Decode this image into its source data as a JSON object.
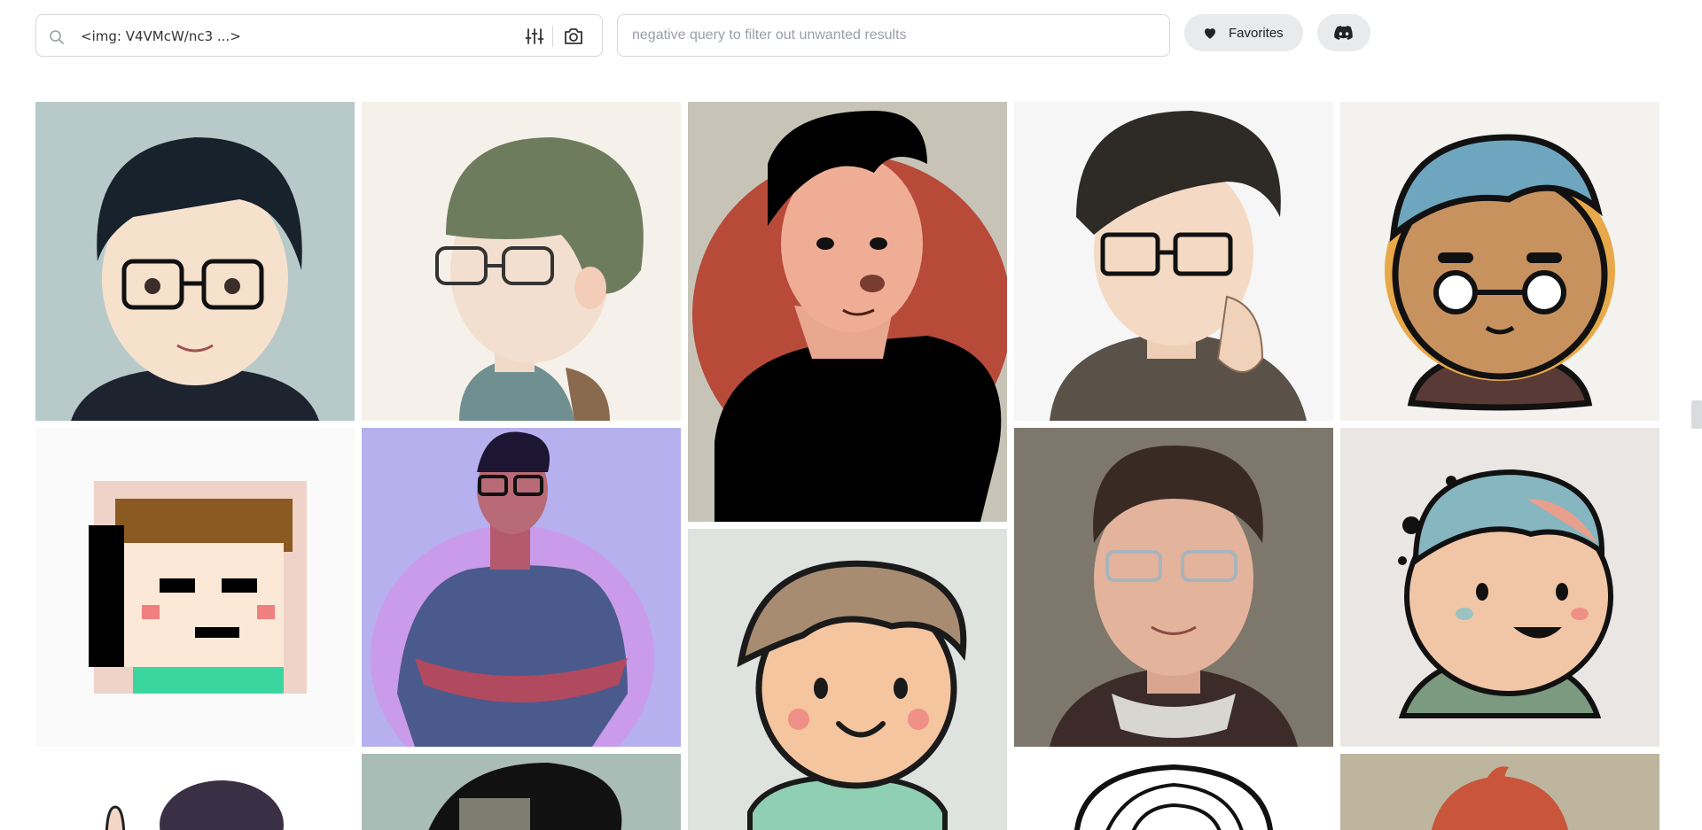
{
  "search": {
    "query": "<img: V4VMcW/nc3 ...>",
    "negative_placeholder": "negative query to filter out unwanted results",
    "search_icon": "search-icon",
    "filters_icon": "sliders-icon",
    "camera_icon": "camera-icon"
  },
  "buttons": {
    "favorites_label": "Favorites",
    "favorites_icon": "heart-icon",
    "discord_icon": "discord-icon"
  },
  "results": {
    "images": [
      {
        "name": "avatar-boy-glasses-anime",
        "bg": "#b7c9c8"
      },
      {
        "name": "avatar-watercolor-boy-glasses",
        "bg": "#f5f1ea"
      },
      {
        "name": "avatar-cartoon-man-red-circle",
        "bg": "#c7c4b7"
      },
      {
        "name": "avatar-boy-glasses-hand",
        "bg": "#f6f6f6"
      },
      {
        "name": "avatar-flat-blue-hair-glasses",
        "bg": "#f4f2ef"
      },
      {
        "name": "avatar-pixel-art-boy",
        "bg": "#fafafa"
      },
      {
        "name": "avatar-man-crossed-arms-purple",
        "bg": "#b6b0ef"
      },
      {
        "name": "avatar-cartoon-boy-brown-hair",
        "bg": "#dfe3e0"
      },
      {
        "name": "avatar-painted-boy-glasses",
        "bg": "#7d776c"
      },
      {
        "name": "avatar-flat-teal-hair-smile",
        "bg": "#e9e6e3"
      },
      {
        "name": "avatar-partial-1",
        "bg": "#ffffff"
      },
      {
        "name": "avatar-partial-2",
        "bg": "#a9bcb6"
      },
      {
        "name": "avatar-partial-3",
        "bg": "#ffffff"
      },
      {
        "name": "avatar-partial-4",
        "bg": "#bdb59d"
      }
    ]
  },
  "colors": {
    "border": "#d5d7db",
    "button_bg": "#e9eaec",
    "placeholder": "#9a9ea6"
  }
}
